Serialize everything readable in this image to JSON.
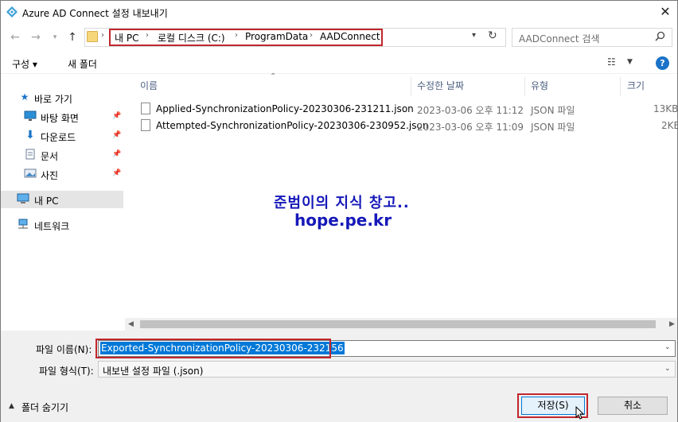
{
  "window": {
    "title": "Azure AD Connect 설정 내보내기",
    "close_glyph": "✕"
  },
  "address": {
    "crumbs": [
      "내 PC",
      "로컬 디스크 (C:)",
      "ProgramData",
      "AADConnect"
    ],
    "search_placeholder": "AADConnect 검색"
  },
  "toolbar": {
    "organize_label": "구성 ▾",
    "new_folder_label": "새 폴더",
    "help_glyph": "?"
  },
  "nav": {
    "items": [
      {
        "label": "바로 가기",
        "icon": "star-icon"
      },
      {
        "label": "바탕 화면",
        "icon": "desktop-icon",
        "pinned": true
      },
      {
        "label": "다운로드",
        "icon": "download-icon",
        "pinned": true
      },
      {
        "label": "문서",
        "icon": "document-icon",
        "pinned": true
      },
      {
        "label": "사진",
        "icon": "picture-icon",
        "pinned": true
      },
      {
        "label": "내 PC",
        "icon": "computer-icon",
        "selected": true
      },
      {
        "label": "네트워크",
        "icon": "network-icon"
      }
    ]
  },
  "file_list": {
    "columns": [
      "이름",
      "수정한 날짜",
      "유형",
      "크기"
    ],
    "rows": [
      {
        "name": "Applied-SynchronizationPolicy-20230306-231211.json",
        "date": "2023-03-06 오후 11:12",
        "type": "JSON 파일",
        "size": "13KB"
      },
      {
        "name": "Attempted-SynchronizationPolicy-20230306-230952.json",
        "date": "2023-03-06 오후 11:09",
        "type": "JSON 파일",
        "size": "2KB"
      }
    ]
  },
  "watermark": {
    "line1": "준범이의 지식 창고..",
    "line2": "hope.pe.kr"
  },
  "bottom": {
    "filename_label": "파일 이름(N):",
    "filename_value": "Exported-SynchronizationPolicy-20230306-232156",
    "filetype_label": "파일 형식(T):",
    "filetype_value": "내보낸 설정 파일 (.json)",
    "hide_folders_label": "폴더 숨기기",
    "save_label": "저장(S)",
    "cancel_label": "취소"
  },
  "colors": {
    "highlight_border": "#c0272d",
    "selection": "#0078d7",
    "watermark": "#1518b8"
  }
}
